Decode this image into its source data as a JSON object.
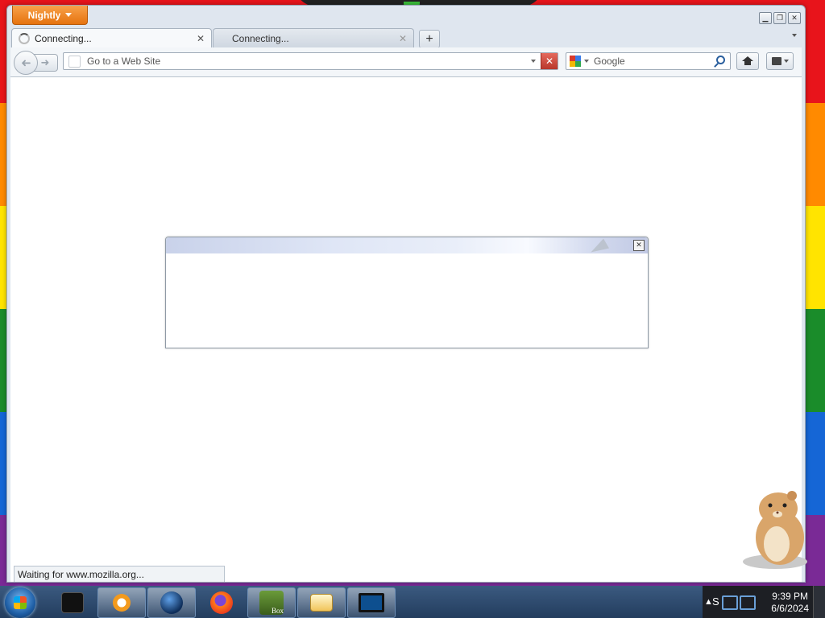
{
  "window": {
    "app_menu_label": "Nightly"
  },
  "tabs": [
    {
      "label": "Connecting...",
      "active": true
    },
    {
      "label": "Connecting...",
      "active": false
    }
  ],
  "navbar": {
    "url_placeholder": "Go to a Web Site",
    "search_engine": "Google"
  },
  "status": {
    "text": "Waiting for www.mozilla.org..."
  },
  "taskbar": {
    "items": [
      "terminal-icon",
      "media-player-icon",
      "globe-icon",
      "firefox-icon",
      "box-game-icon",
      "mail-icon",
      "monitor-icon"
    ],
    "box_label": "Box",
    "tray_letter": "S",
    "time": "9:39 PM",
    "date": "6/6/2024"
  },
  "colors": {
    "accent_orange": "#e5730f",
    "stop_red": "#c43c30",
    "wallpaper": [
      "#e8141b",
      "#ff8a00",
      "#ffe400",
      "#1a8c2a",
      "#1566d6",
      "#7a2a96"
    ]
  }
}
